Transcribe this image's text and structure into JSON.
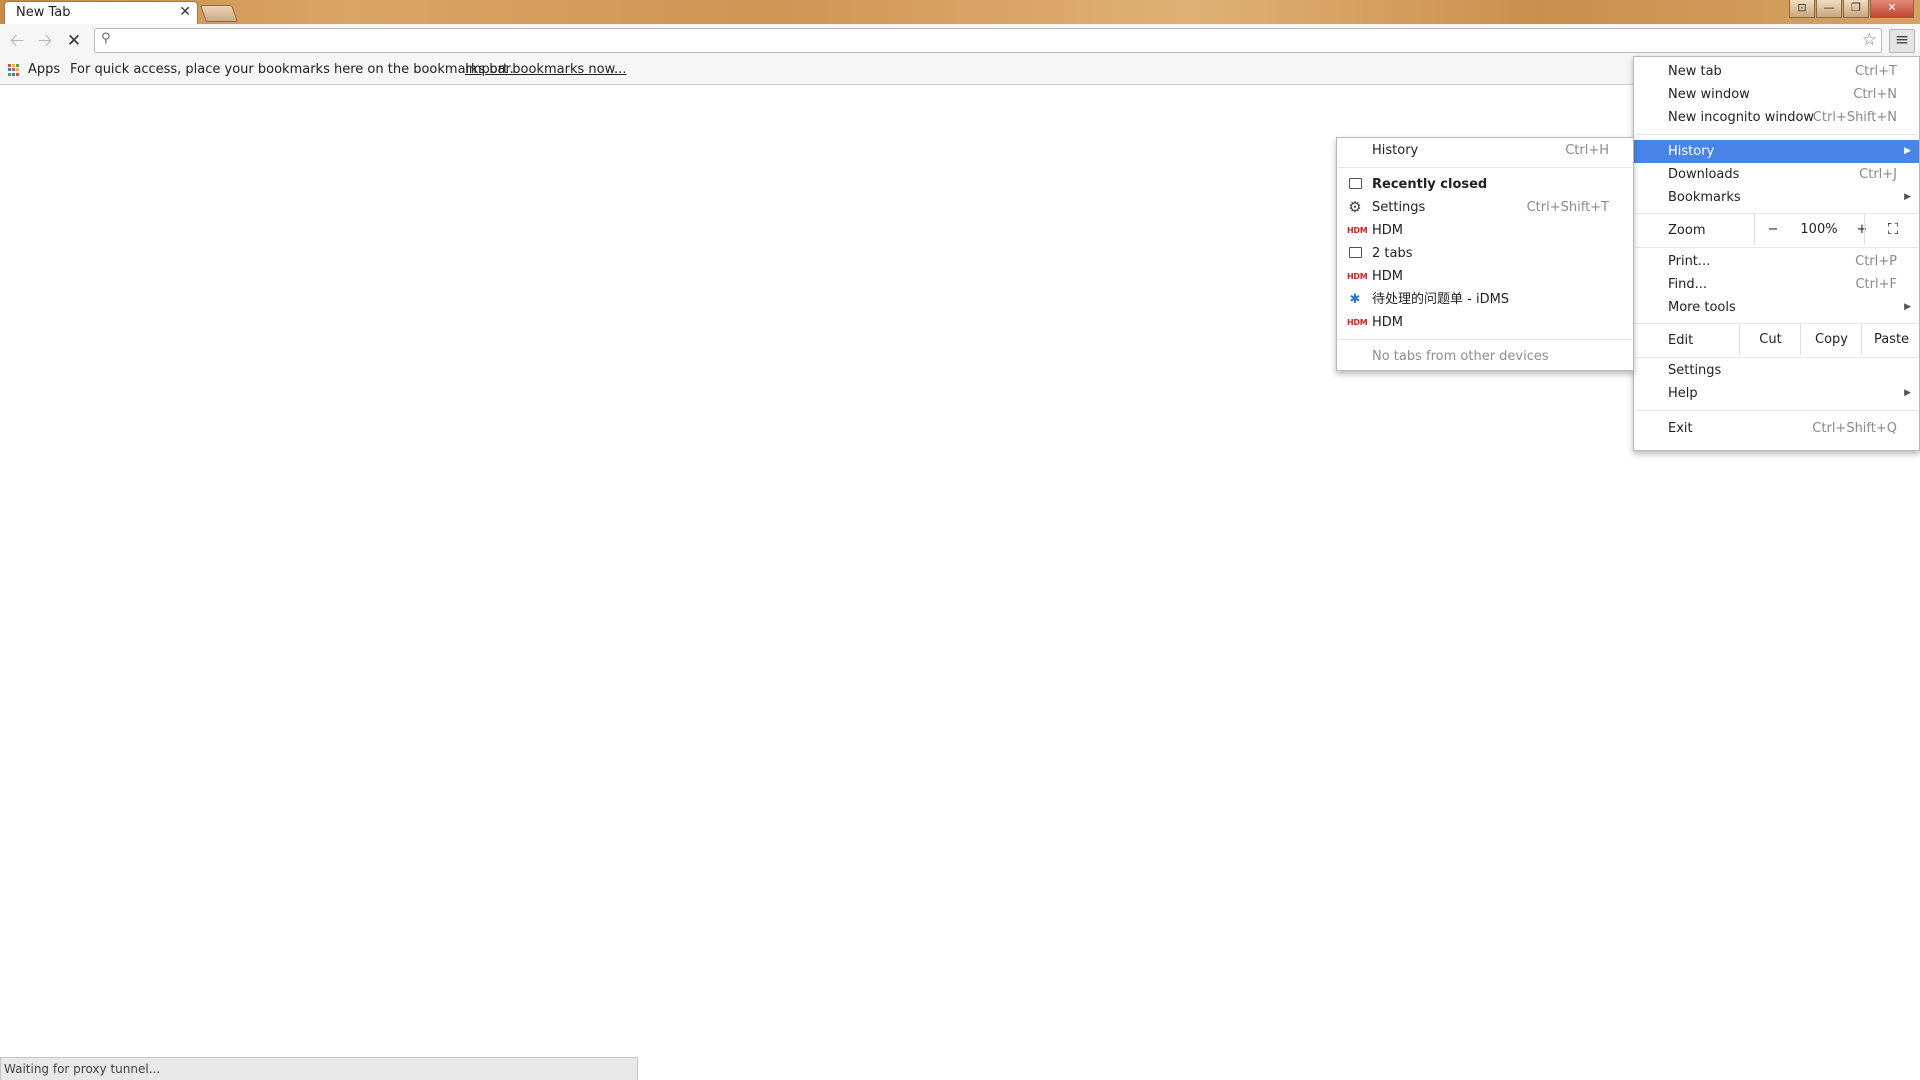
{
  "window": {
    "tab_title": "New Tab",
    "tab_close": "✕",
    "controls": [
      "⊡",
      "—",
      "❐",
      "✕"
    ]
  },
  "toolbar": {
    "back": "🡠",
    "forward": "🡢",
    "stop": "✕",
    "search_icon": "⚲",
    "star": "☆",
    "menu": "≡",
    "omnibox_value": ""
  },
  "bookmarks_bar": {
    "apps_label": "Apps",
    "hint": "For quick access, place your bookmarks here on the bookmarks bar.",
    "import_link": "Import bookmarks now...",
    "apps_icon_colors": [
      "#e84a3c",
      "#f3b61f",
      "#4ca64c",
      "#3b78e7",
      "#e84a3c",
      "#f3b61f",
      "#4ca64c",
      "#3b78e7",
      "#e84a3c"
    ]
  },
  "main_menu": {
    "new_tab": {
      "label": "New tab",
      "shortcut": "Ctrl+T"
    },
    "new_window": {
      "label": "New window",
      "shortcut": "Ctrl+N"
    },
    "new_incognito": {
      "label": "New incognito window",
      "shortcut": "Ctrl+Shift+N"
    },
    "history": {
      "label": "History",
      "arrow": "▶"
    },
    "downloads": {
      "label": "Downloads",
      "shortcut": "Ctrl+J"
    },
    "bookmarks": {
      "label": "Bookmarks",
      "arrow": "▶"
    },
    "zoom": {
      "label": "Zoom",
      "minus": "−",
      "value": "100%",
      "plus": "+",
      "fullscreen": "⛶"
    },
    "print": {
      "label": "Print...",
      "shortcut": "Ctrl+P"
    },
    "find": {
      "label": "Find...",
      "shortcut": "Ctrl+F"
    },
    "more_tools": {
      "label": "More tools",
      "arrow": "▶"
    },
    "edit": {
      "label": "Edit",
      "cut": "Cut",
      "copy": "Copy",
      "paste": "Paste"
    },
    "settings": {
      "label": "Settings"
    },
    "help": {
      "label": "Help",
      "arrow": "▶"
    },
    "exit": {
      "label": "Exit",
      "shortcut": "Ctrl+Shift+Q"
    }
  },
  "history_submenu": {
    "history": {
      "label": "History",
      "shortcut": "Ctrl+H"
    },
    "recently_closed": "Recently closed",
    "items": [
      {
        "icon": "gear-icon",
        "label": "Settings",
        "shortcut": "Ctrl+Shift+T"
      },
      {
        "icon": "hdm-icon",
        "label": "HDM"
      },
      {
        "icon": "tab-window-icon",
        "label": "2 tabs"
      },
      {
        "icon": "hdm-icon",
        "label": "HDM"
      },
      {
        "icon": "bug-icon",
        "label": "待处理的问题单 - iDMS"
      },
      {
        "icon": "hdm-icon",
        "label": "HDM"
      }
    ],
    "icon_glyphs": {
      "hdm": "HDM",
      "gear": "⚙",
      "bug": "✱"
    },
    "no_tabs": "No tabs from other devices"
  },
  "status": {
    "text": "Waiting for proxy tunnel..."
  }
}
